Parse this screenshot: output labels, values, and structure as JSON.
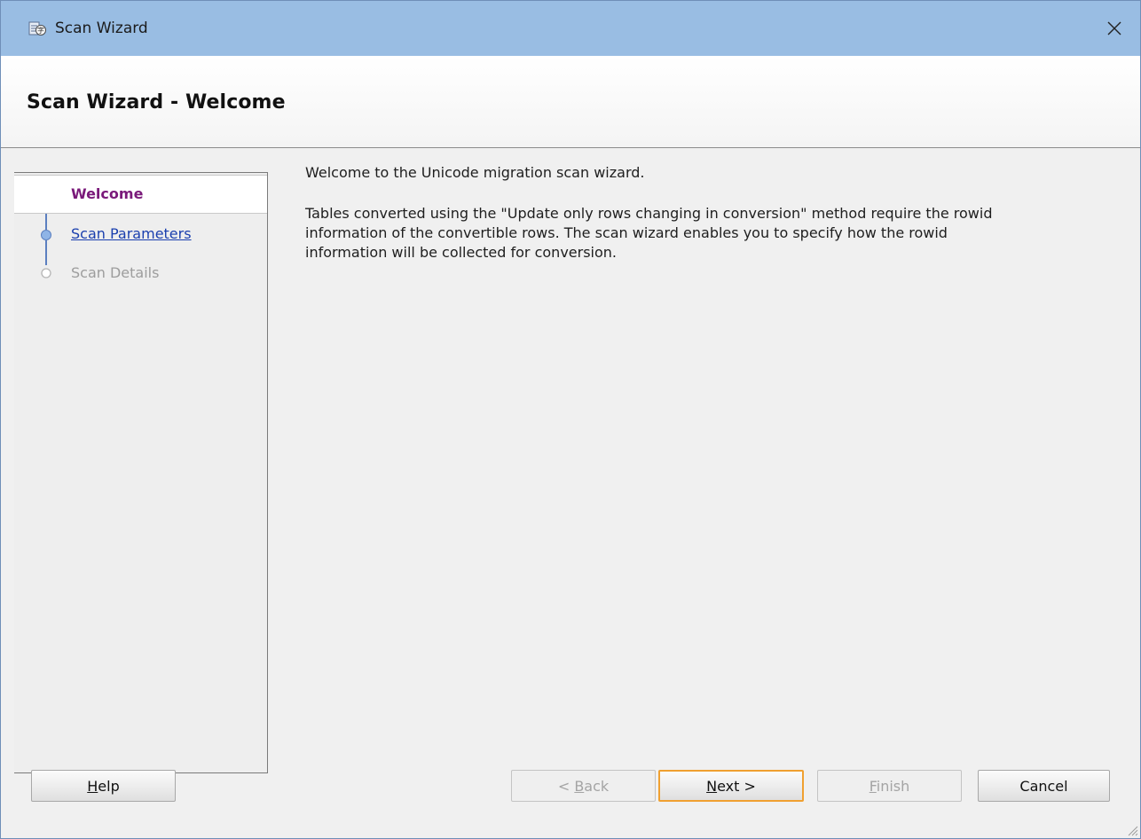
{
  "window": {
    "title": "Scan Wizard"
  },
  "header": {
    "page_title": "Scan Wizard - Welcome"
  },
  "steps": [
    {
      "label": "Welcome",
      "state": "current"
    },
    {
      "label": "Scan Parameters",
      "state": "link"
    },
    {
      "label": "Scan Details",
      "state": "disabled"
    }
  ],
  "content": {
    "paragraph1": "Welcome to the Unicode migration scan wizard.",
    "paragraph2_line1": "Tables converted using the \"Update only rows changing in conversion\" method require the rowid",
    "paragraph2_line2": "information of the convertible rows. The scan wizard enables you to specify how the rowid",
    "paragraph2_line3": "information will be collected for conversion."
  },
  "buttons": {
    "help": {
      "mnemonic": "H",
      "rest": "elp",
      "enabled": true
    },
    "back": {
      "prefix": "< ",
      "mnemonic": "B",
      "rest": "ack",
      "enabled": false
    },
    "next": {
      "mnemonic": "N",
      "rest": "ext >",
      "enabled": true,
      "default": true
    },
    "finish": {
      "mnemonic": "F",
      "rest": "inish",
      "enabled": false
    },
    "cancel": {
      "label": "Cancel",
      "enabled": true
    }
  },
  "colors": {
    "titlebar": "#99bde3",
    "current_step": "#7a1a7a",
    "link_step": "#1a3fae",
    "default_button_border": "#f0a030"
  },
  "icons": [
    "app-icon",
    "close-icon",
    "resize-grip-icon"
  ]
}
